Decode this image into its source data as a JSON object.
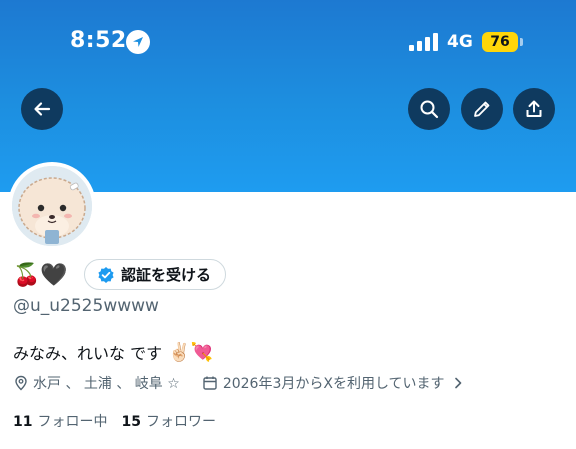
{
  "status_bar": {
    "time": "8:52",
    "network": "4G",
    "battery": "76"
  },
  "header": {
    "back_icon": "arrow-left-icon",
    "search_icon": "search-icon",
    "edit_icon": "pencil-icon",
    "share_icon": "share-upload-icon",
    "button_bg": "#0f3a5f",
    "banner_color": "#1d9bf0"
  },
  "profile": {
    "name_emojis": "🍒🖤",
    "verify_label": "認証を受ける",
    "handle": "@u_u2525wwww",
    "bio": "みなみ、れいな です",
    "bio_emojis": "✌🏻💘",
    "location": "水戸 、 土浦 、 岐阜 ☆",
    "joined": "2026年3月からXを利用しています",
    "following_count": "11",
    "following_label": "フォロー中",
    "followers_count": "15",
    "followers_label": "フォロワー"
  }
}
